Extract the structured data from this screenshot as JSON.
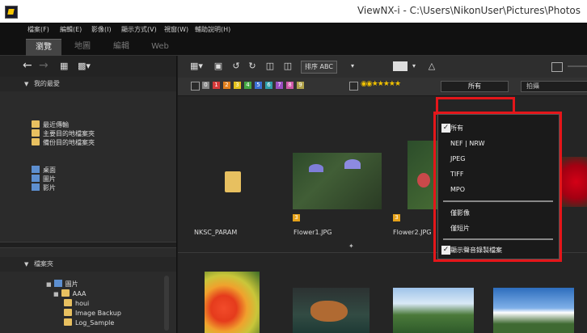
{
  "window": {
    "title": "ViewNX-i - C:\\Users\\NikonUser\\Pictures\\Photos"
  },
  "menu": [
    "檔案(F)",
    "編輯(E)",
    "影像(I)",
    "顯示方式(V)",
    "視窗(W)",
    "輔助說明(H)"
  ],
  "workspace_tabs": [
    {
      "label": "瀏覽",
      "active": true
    },
    {
      "label": "地圖",
      "active": false
    },
    {
      "label": "編輯",
      "active": false
    },
    {
      "label": "Web",
      "active": false
    }
  ],
  "left_panel": {
    "favorites_title": "我的最愛",
    "favorites": [
      "最近傳輸",
      "主要目的地檔案夾",
      "備份目的地檔案夾"
    ],
    "shortcuts": [
      "桌面",
      "圖片",
      "影片"
    ],
    "folders_title": "檔案夾",
    "tree": [
      "圖片",
      "AAA",
      "houi",
      "Image Backup",
      "Log_Sample"
    ]
  },
  "toolbar": {
    "sort_label": "排序 ABC",
    "labels": [
      "0",
      "1",
      "2",
      "3",
      "4",
      "5",
      "6",
      "7",
      "8",
      "9"
    ],
    "label_colors": [
      "#888888",
      "#d63a3a",
      "#e07f1d",
      "#e4c21a",
      "#43a843",
      "#3a6fd6",
      "#2f9ea8",
      "#9a4ec2",
      "#cf58a8",
      "#b0a24a"
    ],
    "filter_value": "所有",
    "filter2_value": "拍攝"
  },
  "thumbnails": [
    {
      "name": "NKSC_PARAM",
      "type": "folder"
    },
    {
      "name": "Flower1.JPG",
      "type": "image",
      "tag": "3"
    },
    {
      "name": "Flower2.JPG",
      "type": "image",
      "tag": "3"
    }
  ],
  "dropdown": {
    "items": [
      {
        "label": "所有",
        "checked": true
      },
      {
        "label": "NEF | NRW",
        "checked": false
      },
      {
        "label": "JPEG",
        "checked": false
      },
      {
        "label": "TIFF",
        "checked": false
      },
      {
        "label": "MPO",
        "checked": false
      },
      {
        "label": "僅影像",
        "checked": false
      },
      {
        "label": "僅短片",
        "checked": false
      },
      {
        "label": "顯示聲音錄製檔案",
        "checked": true
      }
    ]
  }
}
